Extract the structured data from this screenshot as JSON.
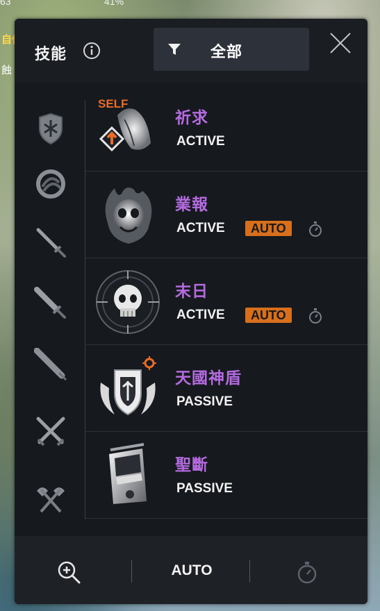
{
  "hud": {
    "top_left": "63",
    "top_middle": "41%",
    "line2": "自信",
    "line3": "蝕"
  },
  "header": {
    "title": "技能",
    "filter_label": "全部",
    "icons": [
      "info-icon",
      "filter-icon",
      "close-icon"
    ]
  },
  "sidebar": {
    "categories": [
      {
        "name": "shield-category",
        "icon": "shield-icon"
      },
      {
        "name": "orb-category",
        "icon": "orb-icon"
      },
      {
        "name": "sword-category",
        "icon": "sword-icon"
      },
      {
        "name": "greatsword-category",
        "icon": "greatsword-icon"
      },
      {
        "name": "spear-category",
        "icon": "spear-icon"
      },
      {
        "name": "dual-sword-category",
        "icon": "crossed-swords-icon"
      },
      {
        "name": "axe-category",
        "icon": "crossed-axes-icon"
      }
    ]
  },
  "skills": [
    {
      "name": "祈求",
      "type": "ACTIVE",
      "auto": "",
      "icon_label": "SELF",
      "icon": "praying-hands-icon"
    },
    {
      "name": "業報",
      "type": "ACTIVE",
      "auto": "AUTO",
      "icon": "flaming-skull-icon"
    },
    {
      "name": "末日",
      "type": "ACTIVE",
      "auto": "AUTO",
      "icon": "targeted-skull-icon"
    },
    {
      "name": "天國神盾",
      "type": "PASSIVE",
      "auto": "",
      "icon": "winged-shield-icon"
    },
    {
      "name": "聖斷",
      "type": "PASSIVE",
      "auto": "",
      "icon": "guillotine-icon"
    }
  ],
  "footer": {
    "auto_label": "AUTO",
    "icons": [
      "zoom-in-icon",
      "stopwatch-icon"
    ]
  },
  "colors": {
    "panel_bg": "#16191e",
    "skill_name": "#b56be0",
    "auto_badge": "#d86f1d",
    "self_label": "#e86d28"
  }
}
